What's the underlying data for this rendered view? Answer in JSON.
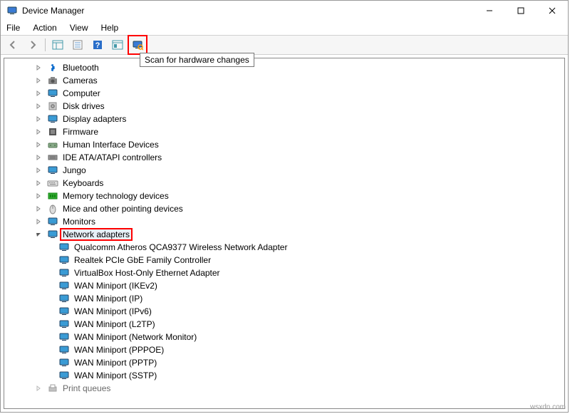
{
  "title": "Device Manager",
  "menu": {
    "file": "File",
    "action": "Action",
    "view": "View",
    "help": "Help"
  },
  "tooltip": "Scan for hardware changes",
  "categories": [
    {
      "icon": "bluetooth",
      "label": "Bluetooth",
      "expandable": true
    },
    {
      "icon": "camera",
      "label": "Cameras",
      "expandable": true
    },
    {
      "icon": "computer",
      "label": "Computer",
      "expandable": true
    },
    {
      "icon": "disk",
      "label": "Disk drives",
      "expandable": true
    },
    {
      "icon": "display",
      "label": "Display adapters",
      "expandable": true
    },
    {
      "icon": "firmware",
      "label": "Firmware",
      "expandable": true
    },
    {
      "icon": "hid",
      "label": "Human Interface Devices",
      "expandable": true
    },
    {
      "icon": "ide",
      "label": "IDE ATA/ATAPI controllers",
      "expandable": true
    },
    {
      "icon": "jungo",
      "label": "Jungo",
      "expandable": true
    },
    {
      "icon": "keyboard",
      "label": "Keyboards",
      "expandable": true
    },
    {
      "icon": "memory",
      "label": "Memory technology devices",
      "expandable": true
    },
    {
      "icon": "mouse",
      "label": "Mice and other pointing devices",
      "expandable": true
    },
    {
      "icon": "monitor",
      "label": "Monitors",
      "expandable": true
    }
  ],
  "network": {
    "icon": "network",
    "label": "Network adapters",
    "expanded": true,
    "highlighted": true,
    "children": [
      "Qualcomm Atheros QCA9377 Wireless Network Adapter",
      "Realtek PCIe GbE Family Controller",
      "VirtualBox Host-Only Ethernet Adapter",
      "WAN Miniport (IKEv2)",
      "WAN Miniport (IP)",
      "WAN Miniport (IPv6)",
      "WAN Miniport (L2TP)",
      "WAN Miniport (Network Monitor)",
      "WAN Miniport (PPPOE)",
      "WAN Miniport (PPTP)",
      "WAN Miniport (SSTP)"
    ]
  },
  "partial": {
    "icon": "printqueue",
    "label": "Print queues"
  },
  "watermark": "wsxdn.com"
}
